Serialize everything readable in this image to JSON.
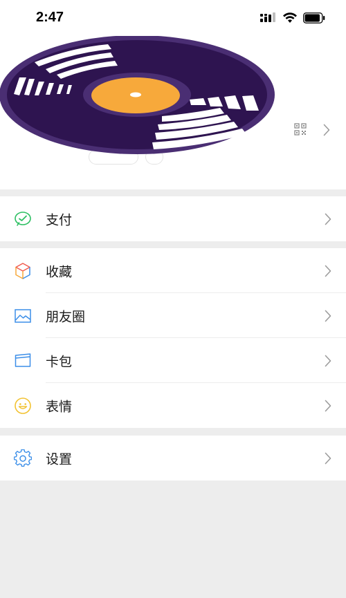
{
  "status_bar": {
    "time": "2:47"
  },
  "profile": {
    "avatar_icon": "vinyl-record-icon",
    "qr_icon": "qr-code-icon"
  },
  "menu": {
    "pay": {
      "label": "支付",
      "icon": "wechat-pay-icon"
    },
    "favorites": {
      "label": "收藏",
      "icon": "cube-icon"
    },
    "moments": {
      "label": "朋友圈",
      "icon": "picture-icon"
    },
    "cards": {
      "label": "卡包",
      "icon": "card-icon"
    },
    "stickers": {
      "label": "表情",
      "icon": "smiley-icon"
    },
    "settings": {
      "label": "设置",
      "icon": "gear-icon"
    }
  },
  "colors": {
    "record_purple": "#2e1450",
    "record_rim": "#4a2e73",
    "record_label": "#f7a93b",
    "pay_green": "#2cbf62",
    "background_gray": "#ededed"
  }
}
